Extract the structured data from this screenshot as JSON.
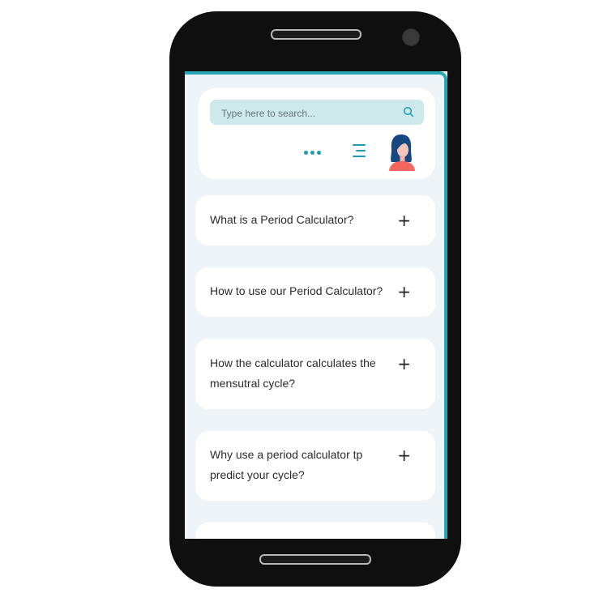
{
  "search": {
    "placeholder": "Type here to search..."
  },
  "header": {
    "more_icon": "more-dots-icon",
    "menu_icon": "menu-icon",
    "avatar": "user-avatar"
  },
  "faq": {
    "expand_symbol": "+",
    "items": [
      {
        "question": "What is a Period Calculator?"
      },
      {
        "question": "How to use our Period Calculator?"
      },
      {
        "question": "How the calculator calculates the mensutral cycle?"
      },
      {
        "question": "Why use a period calculator tp predict your cycle?"
      }
    ]
  },
  "colors": {
    "accent": "#1b9bb3",
    "search_bg": "#cde9ec",
    "screen_bg": "#eef4f7",
    "phone_body": "#0f0f0f"
  }
}
